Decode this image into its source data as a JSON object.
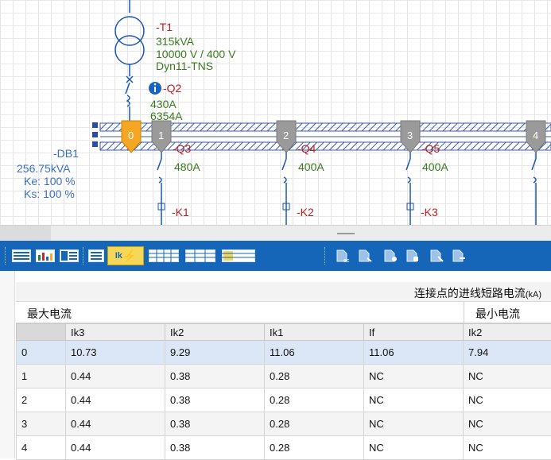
{
  "diagram": {
    "transformer": {
      "tag": "-T1",
      "power": "315kVA",
      "voltage": "10000 V / 400 V",
      "vector": "Dyn11-TNS"
    },
    "breaker_q2": {
      "tag": "-Q2",
      "current": "430A",
      "ik": "6354A"
    },
    "board": {
      "tag": "-DB1",
      "power": "256.75kVA",
      "ke": "Ke: 100 %",
      "ks": "Ks: 100 %"
    },
    "taps": [
      {
        "number": "0"
      },
      {
        "number": "1",
        "breaker": "-Q3",
        "rating": "480A",
        "load": "-K1"
      },
      {
        "number": "2",
        "breaker": "-Q4",
        "rating": "400A",
        "load": "-K2"
      },
      {
        "number": "3",
        "breaker": "-Q5",
        "rating": "400A",
        "load": "-K3"
      },
      {
        "number": "4"
      }
    ],
    "colors": {
      "tag_red": "#b22222",
      "value_green": "#3a7a1e",
      "board_blue": "#3b6fc4",
      "active_tap": "#f5a623",
      "tap_grey": "#9a9a9a"
    }
  },
  "toolbar": {
    "background": "#1565b8",
    "buttons": [
      {
        "icon": "list-view-icon"
      },
      {
        "icon": "chart-view-icon"
      },
      {
        "icon": "detail-list-icon"
      },
      {
        "icon": "short-circuit-icon",
        "label": "Ik",
        "active": true
      },
      {
        "icon": "table-grid-icon"
      },
      {
        "icon": "table-grid-alt-icon"
      },
      {
        "icon": "highlight-table-icon"
      },
      {
        "icon": "calc-ec-icon"
      },
      {
        "icon": "calc-back-icon"
      },
      {
        "icon": "calc-forward-icon"
      },
      {
        "icon": "calc-multi-icon"
      },
      {
        "icon": "calc-select-icon"
      },
      {
        "icon": "calc-next-icon"
      }
    ]
  },
  "panel": {
    "title": "连接点的进线短路电流",
    "title_unit": "(kA)",
    "group_max": "最大电流",
    "group_min": "最小电流",
    "columns": [
      "",
      "Ik3",
      "Ik2",
      "Ik1",
      "If",
      "Ik2"
    ],
    "rows": [
      [
        "0",
        "10.73",
        "9.29",
        "11.06",
        "11.06",
        "7.94"
      ],
      [
        "1",
        "0.44",
        "0.38",
        "0.28",
        "NC",
        "NC"
      ],
      [
        "2",
        "0.44",
        "0.38",
        "0.28",
        "NC",
        "NC"
      ],
      [
        "3",
        "0.44",
        "0.38",
        "0.28",
        "NC",
        "NC"
      ],
      [
        "4",
        "0.44",
        "0.38",
        "0.28",
        "NC",
        "NC"
      ]
    ]
  }
}
